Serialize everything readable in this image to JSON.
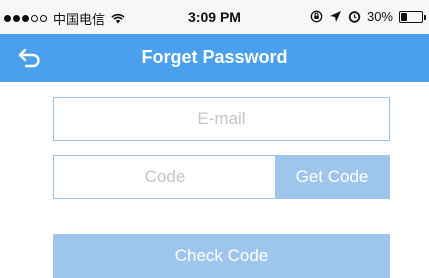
{
  "status_bar": {
    "carrier": "中国电信",
    "time": "3:09 PM",
    "battery_percent_text": "30%",
    "battery_level": 0.3,
    "icons": [
      "signal-dots",
      "wifi",
      "rotation-lock",
      "location-arrow",
      "alarm",
      "battery"
    ]
  },
  "nav": {
    "title": "Forget Password",
    "back_icon": "back-arrow-icon"
  },
  "form": {
    "email_placeholder": "E-mail",
    "email_value": "",
    "code_placeholder": "Code",
    "code_value": "",
    "get_code_label": "Get Code",
    "check_code_label": "Check Code"
  },
  "colors": {
    "nav_background": "#4aa0ec",
    "button_background": "#9ec6ec",
    "field_border": "#9ec6ec",
    "placeholder": "#c4c4c4"
  }
}
